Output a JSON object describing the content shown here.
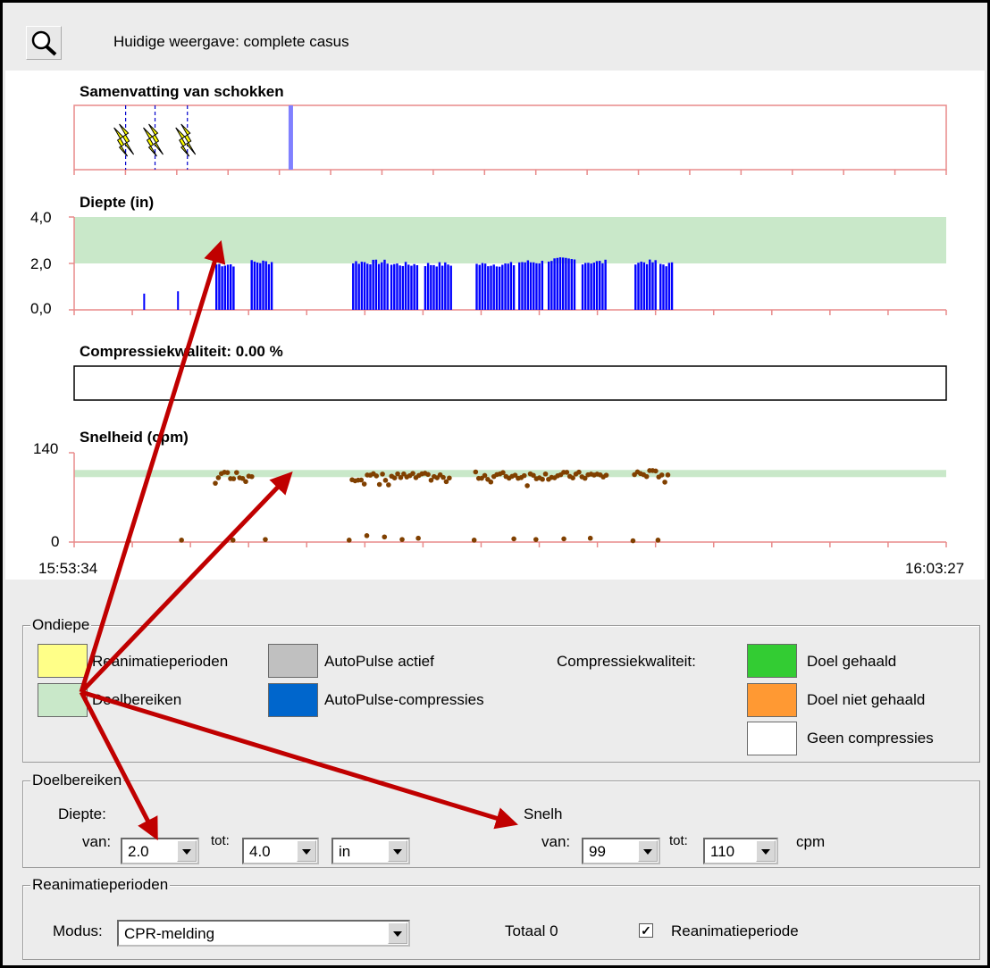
{
  "header": {
    "current_view_label": "Huidige weergave: complete casus"
  },
  "charts": {
    "shocks_title": "Samenvatting van schokken",
    "depth_title": "Diepte (in)",
    "depth_ticks": [
      "4,0",
      "2,0",
      "0,0"
    ],
    "quality_title": "Compressiekwaliteit: 0.00 %",
    "rate_title": "Snelheid (cpm)",
    "rate_ticks": [
      "140",
      "0"
    ],
    "time_start": "15:53:34",
    "time_end": "16:03:27"
  },
  "chart_data": [
    {
      "type": "scatter",
      "title": "Samenvatting van schokken",
      "x_range": [
        "15:53:34",
        "16:03:27"
      ],
      "shocks": [
        "15:54:09",
        "15:54:29",
        "15:54:51"
      ],
      "current_marker": "15:56:01"
    },
    {
      "type": "bar",
      "title": "Diepte (in)",
      "ylim": [
        0,
        4
      ],
      "target_band": [
        2.0,
        4.0
      ],
      "x_range": [
        "15:53:34",
        "16:03:27"
      ],
      "bursts": [
        {
          "start": "15:55:10",
          "end": "15:55:22",
          "value": 2.0
        },
        {
          "start": "15:55:34",
          "end": "15:55:49",
          "value": 2.1
        },
        {
          "start": "15:56:43",
          "end": "15:57:07",
          "value": 2.1
        },
        {
          "start": "15:57:09",
          "end": "15:57:27",
          "value": 2.0
        },
        {
          "start": "15:57:32",
          "end": "15:57:51",
          "value": 2.0
        },
        {
          "start": "15:58:07",
          "end": "15:58:33",
          "value": 2.0
        },
        {
          "start": "15:58:36",
          "end": "15:58:52",
          "value": 2.1
        },
        {
          "start": "15:58:56",
          "end": "15:59:15",
          "value": 2.2
        },
        {
          "start": "15:59:19",
          "end": "15:59:36",
          "value": 2.1
        },
        {
          "start": "15:59:55",
          "end": "16:00:09",
          "value": 2.1
        },
        {
          "start": "16:00:12",
          "end": "16:00:20",
          "value": 2.0
        }
      ],
      "spikes": [
        {
          "t": "15:54:21",
          "value": 0.7
        },
        {
          "t": "15:54:44",
          "value": 0.8
        }
      ]
    },
    {
      "type": "bar",
      "title": "Compressiekwaliteit: 0.00 %",
      "values": [
        0.0
      ]
    },
    {
      "type": "scatter",
      "title": "Snelheid (cpm)",
      "ylim": [
        0,
        140
      ],
      "target_band": [
        99,
        110
      ],
      "x_range": [
        "15:53:34",
        "16:03:27"
      ],
      "clusters": [
        {
          "start": "15:55:10",
          "end": "15:55:36",
          "value": 105
        },
        {
          "start": "15:56:43",
          "end": "15:57:50",
          "value": 102
        },
        {
          "start": "15:58:07",
          "end": "15:59:37",
          "value": 104
        },
        {
          "start": "15:59:55",
          "end": "16:00:18",
          "value": 107
        }
      ],
      "low_points": [
        {
          "t": "15:54:11",
          "value": 2
        },
        {
          "t": "15:54:47",
          "value": 3
        },
        {
          "t": "15:55:22",
          "value": 3
        },
        {
          "t": "15:55:44",
          "value": 4
        },
        {
          "t": "15:56:41",
          "value": 3
        },
        {
          "t": "15:56:53",
          "value": 10
        },
        {
          "t": "15:57:05",
          "value": 8
        },
        {
          "t": "15:57:17",
          "value": 4
        },
        {
          "t": "15:57:28",
          "value": 6
        },
        {
          "t": "15:58:06",
          "value": 3
        },
        {
          "t": "15:58:33",
          "value": 5
        },
        {
          "t": "15:58:48",
          "value": 4
        },
        {
          "t": "15:59:07",
          "value": 5
        },
        {
          "t": "15:59:25",
          "value": 6
        },
        {
          "t": "15:59:54",
          "value": 2
        },
        {
          "t": "16:00:11",
          "value": 3
        }
      ]
    }
  ],
  "legend": {
    "title": "Ondiepe",
    "cpr_periods": "Reanimatieperioden",
    "target_ranges": "Doelbereiken",
    "autopulse_active": "AutoPulse actief",
    "autopulse_compressions": "AutoPulse-compressies",
    "quality_label": "Compressiekwaliteit:",
    "goal_met": "Doel gehaald",
    "goal_not_met": "Doel niet gehaald",
    "no_compressions": "Geen compressies",
    "colors": {
      "yellow": "#ffff88",
      "green_band": "#c9e8c9",
      "gray": "#c0c0c0",
      "blue": "#0066cc",
      "green": "#33cc33",
      "orange": "#ff9933",
      "white": "#ffffff",
      "depth_bars": "#0000ff",
      "rate_points": "#804000",
      "arrow": "#c00000"
    }
  },
  "targets": {
    "title": "Doelbereiken",
    "depth_label": "Diepte:",
    "from_label": "van:",
    "to_label": "tot:",
    "depth_from": "2.0",
    "depth_to": "4.0",
    "depth_unit": "in",
    "rate_label": "Snelh",
    "rate_from": "99",
    "rate_to": "110",
    "rate_unit": "cpm"
  },
  "cpr": {
    "title": "Reanimatieperioden",
    "mode_label": "Modus:",
    "mode_value": "CPR-melding",
    "total_label": "Totaal 0",
    "checkbox_label": "Reanimatieperiode",
    "checkbox_mark": "✓"
  }
}
